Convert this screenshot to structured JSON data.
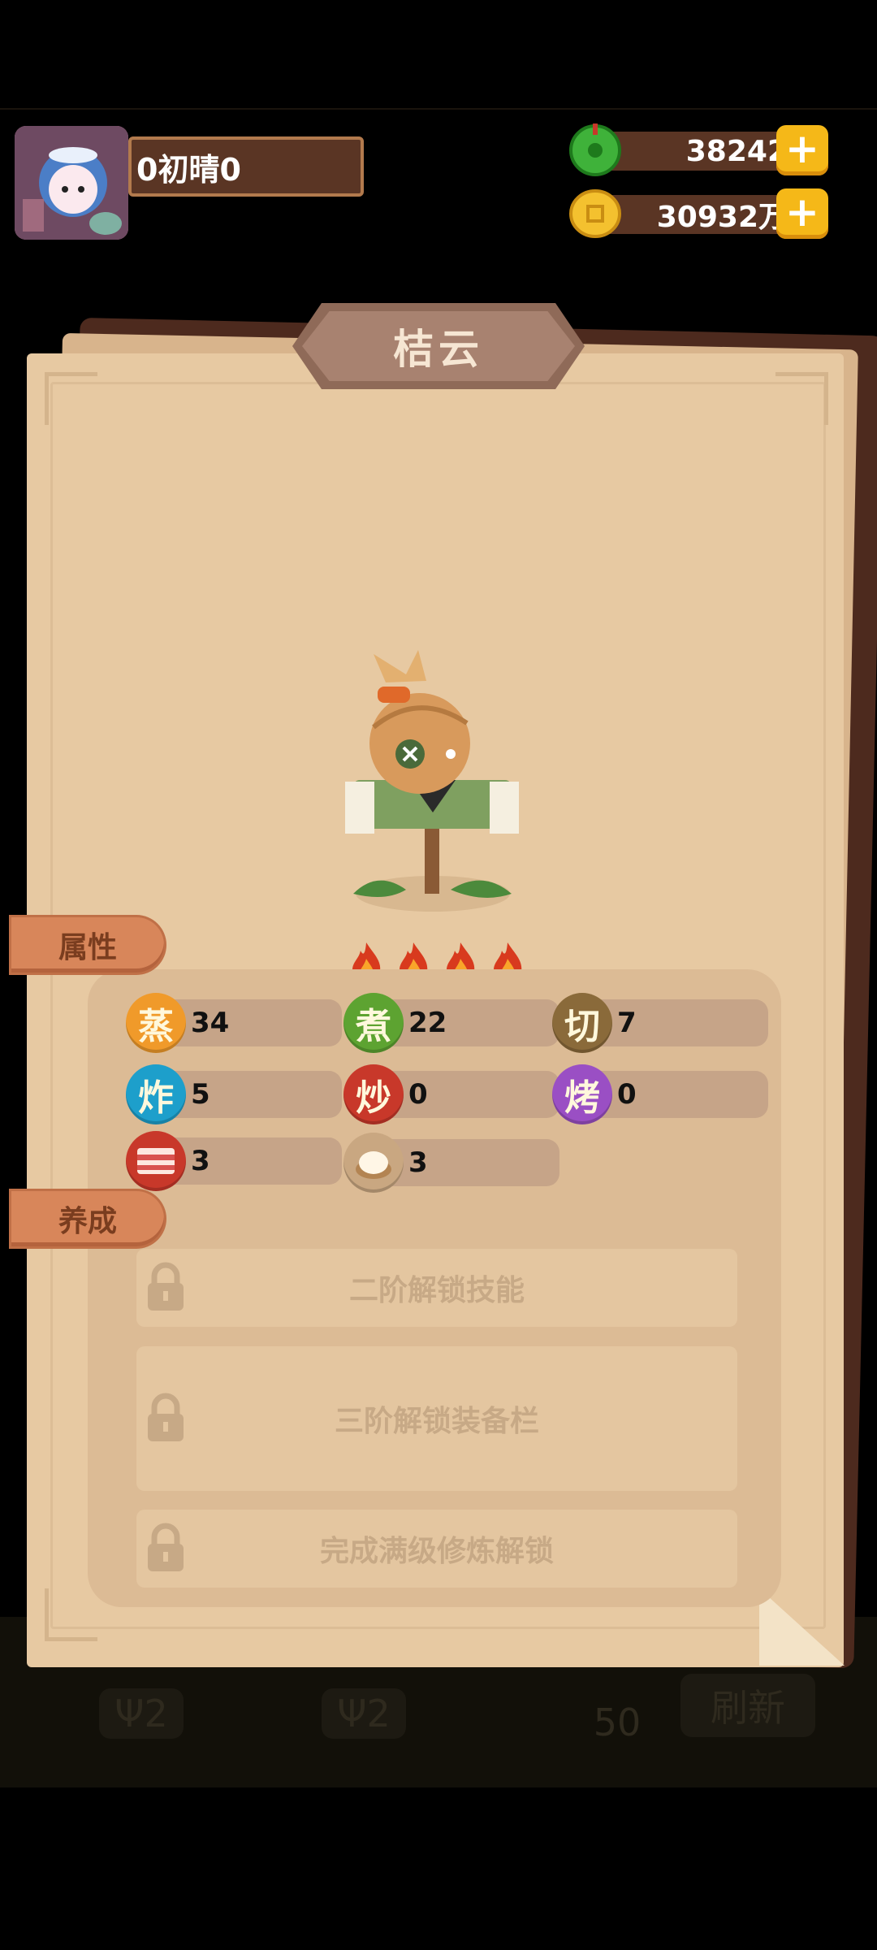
{
  "player": {
    "name": "0初晴0"
  },
  "currency": {
    "jade": "38242",
    "coins": "30932万"
  },
  "background": {
    "cost_a": "2",
    "cost_b": "2",
    "refresh_cost": "50",
    "refresh_label": "刷新"
  },
  "panel": {
    "title": "桔云",
    "stars": 4
  },
  "sections": {
    "attributes": "属性",
    "cultivation": "养成"
  },
  "stats": [
    {
      "char": "蒸",
      "value": "34",
      "color": "#f09a2a"
    },
    {
      "char": "煮",
      "value": "22",
      "color": "#5da331"
    },
    {
      "char": "切",
      "value": "7",
      "color": "#8a6a3a"
    },
    {
      "char": "炸",
      "value": "5",
      "color": "#1d9fcb"
    },
    {
      "char": "炒",
      "value": "0",
      "color": "#c8382a"
    },
    {
      "char": "烤",
      "value": "0",
      "color": "#9a4fc4"
    },
    {
      "char": "",
      "value": "3",
      "color": "#c8382a",
      "icon": "meat-icon"
    },
    {
      "char": "",
      "value": "3",
      "color": "#c9a781",
      "icon": "dumpling-icon"
    }
  ],
  "locks": [
    "二阶解锁技能",
    "三阶解锁装备栏",
    "完成满级修炼解锁"
  ]
}
